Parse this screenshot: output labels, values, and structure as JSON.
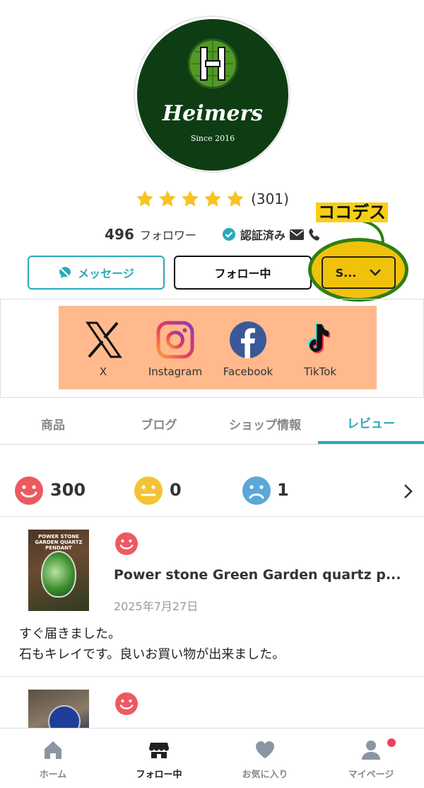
{
  "shop": {
    "logo_name": "Heimers",
    "logo_since": "Since 2016",
    "rating_count": "(301)",
    "followers": "496",
    "followers_label": "フォロワー",
    "verified_label": "認証済み"
  },
  "actions": {
    "message_label": "メッセージ",
    "follow_label": "フォロー中",
    "more_label": "S..."
  },
  "annotation": {
    "text": "ココデス"
  },
  "sns": [
    {
      "label": "X",
      "icon": "x-icon"
    },
    {
      "label": "Instagram",
      "icon": "instagram-icon"
    },
    {
      "label": "Facebook",
      "icon": "facebook-icon"
    },
    {
      "label": "TikTok",
      "icon": "tiktok-icon"
    }
  ],
  "tabs": [
    {
      "label": "商品",
      "active": false
    },
    {
      "label": "ブログ",
      "active": false
    },
    {
      "label": "ショップ情報",
      "active": false
    },
    {
      "label": "レビュー",
      "active": true
    }
  ],
  "review_summary": {
    "good": "300",
    "neutral": "0",
    "bad": "1"
  },
  "reviews": [
    {
      "thumb_text": "POWER STONE\nGARDEN QUARTZ\nPENDANT",
      "title": "Power stone Green Garden quartz p...",
      "date": "2025年7月27日",
      "body_line1": "すぐ届きました。",
      "body_line2": "石もキレイです。良いお買い物が出来ました。"
    }
  ],
  "bottom_nav": [
    {
      "label": "ホーム",
      "icon": "home-icon",
      "active": false
    },
    {
      "label": "フォロー中",
      "icon": "shop-icon",
      "active": true
    },
    {
      "label": "お気に入り",
      "icon": "heart-icon",
      "active": false
    },
    {
      "label": "マイページ",
      "icon": "person-icon",
      "active": false
    }
  ],
  "colors": {
    "accent": "#29a9bd",
    "star": "#f7c325",
    "good": "#ec5a5f",
    "neutral": "#f3c334",
    "bad": "#5aa8d8",
    "annotation_fill": "#f0c20c",
    "annotation_ring": "#2e7f14",
    "sns_bg": "#ffb98c"
  }
}
